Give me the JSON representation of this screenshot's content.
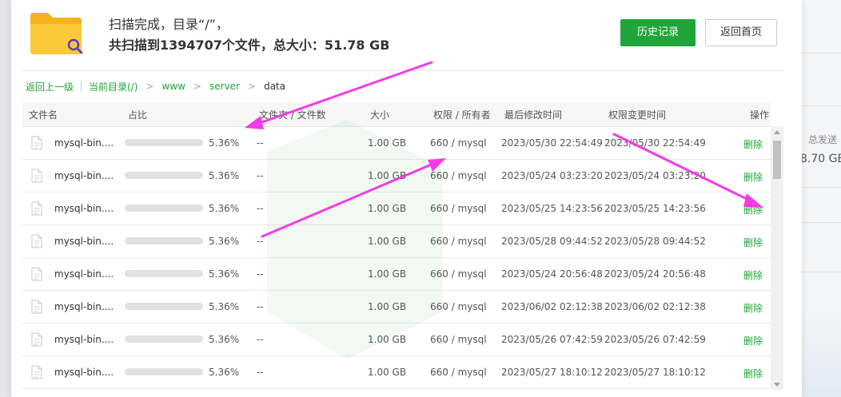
{
  "background": {
    "label": "总发送",
    "value": "8.70 GB"
  },
  "header": {
    "scan_title": "扫描完成，目录“/”，",
    "scan_summary": "共扫描到1394707个文件，总大小：51.78 GB",
    "history_button": "历史记录",
    "home_button": "返回首页",
    "folder_icon": "folder-search-icon"
  },
  "breadcrumb": {
    "back": "返回上一级",
    "current": "当前目录(/)",
    "path": [
      "www",
      "server",
      "data"
    ],
    "separator": ">"
  },
  "table": {
    "columns": [
      "文件名",
      "占比",
      "文件夹 / 文件数",
      "大小",
      "权限 / 所有者",
      "最后修改时间",
      "权限变更时间",
      "操作"
    ],
    "rows": [
      {
        "name": "mysql-bin....",
        "ratio": 0.0536,
        "ratio_text": "5.36%",
        "dir_count": "--",
        "size": "1.00 GB",
        "perm": "660 / mysql",
        "mtime": "2023/05/30 22:54:49",
        "ctime": "2023/05/30 22:54:49",
        "action": "删除"
      },
      {
        "name": "mysql-bin....",
        "ratio": 0.0536,
        "ratio_text": "5.36%",
        "dir_count": "--",
        "size": "1.00 GB",
        "perm": "660 / mysql",
        "mtime": "2023/05/24 03:23:20",
        "ctime": "2023/05/24 03:23:20",
        "action": "删除"
      },
      {
        "name": "mysql-bin....",
        "ratio": 0.0536,
        "ratio_text": "5.36%",
        "dir_count": "--",
        "size": "1.00 GB",
        "perm": "660 / mysql",
        "mtime": "2023/05/25 14:23:56",
        "ctime": "2023/05/25 14:23:56",
        "action": "删除"
      },
      {
        "name": "mysql-bin....",
        "ratio": 0.0536,
        "ratio_text": "5.36%",
        "dir_count": "--",
        "size": "1.00 GB",
        "perm": "660 / mysql",
        "mtime": "2023/05/28 09:44:52",
        "ctime": "2023/05/28 09:44:52",
        "action": "删除"
      },
      {
        "name": "mysql-bin....",
        "ratio": 0.0536,
        "ratio_text": "5.36%",
        "dir_count": "--",
        "size": "1.00 GB",
        "perm": "660 / mysql",
        "mtime": "2023/05/24 20:56:48",
        "ctime": "2023/05/24 20:56:48",
        "action": "删除"
      },
      {
        "name": "mysql-bin....",
        "ratio": 0.0536,
        "ratio_text": "5.36%",
        "dir_count": "--",
        "size": "1.00 GB",
        "perm": "660 / mysql",
        "mtime": "2023/06/02 02:12:38",
        "ctime": "2023/06/02 02:12:38",
        "action": "删除"
      },
      {
        "name": "mysql-bin....",
        "ratio": 0.0536,
        "ratio_text": "5.36%",
        "dir_count": "--",
        "size": "1.00 GB",
        "perm": "660 / mysql",
        "mtime": "2023/05/26 07:42:59",
        "ctime": "2023/05/26 07:42:59",
        "action": "删除"
      },
      {
        "name": "mysql-bin....",
        "ratio": 0.0536,
        "ratio_text": "5.36%",
        "dir_count": "--",
        "size": "1.00 GB",
        "perm": "660 / mysql",
        "mtime": "2023/05/27 18:10:12",
        "ctime": "2023/05/27 18:10:12",
        "action": "删除"
      }
    ]
  },
  "colors": {
    "accent": "#20a53a",
    "annotation_arrow": "#f53be8"
  }
}
